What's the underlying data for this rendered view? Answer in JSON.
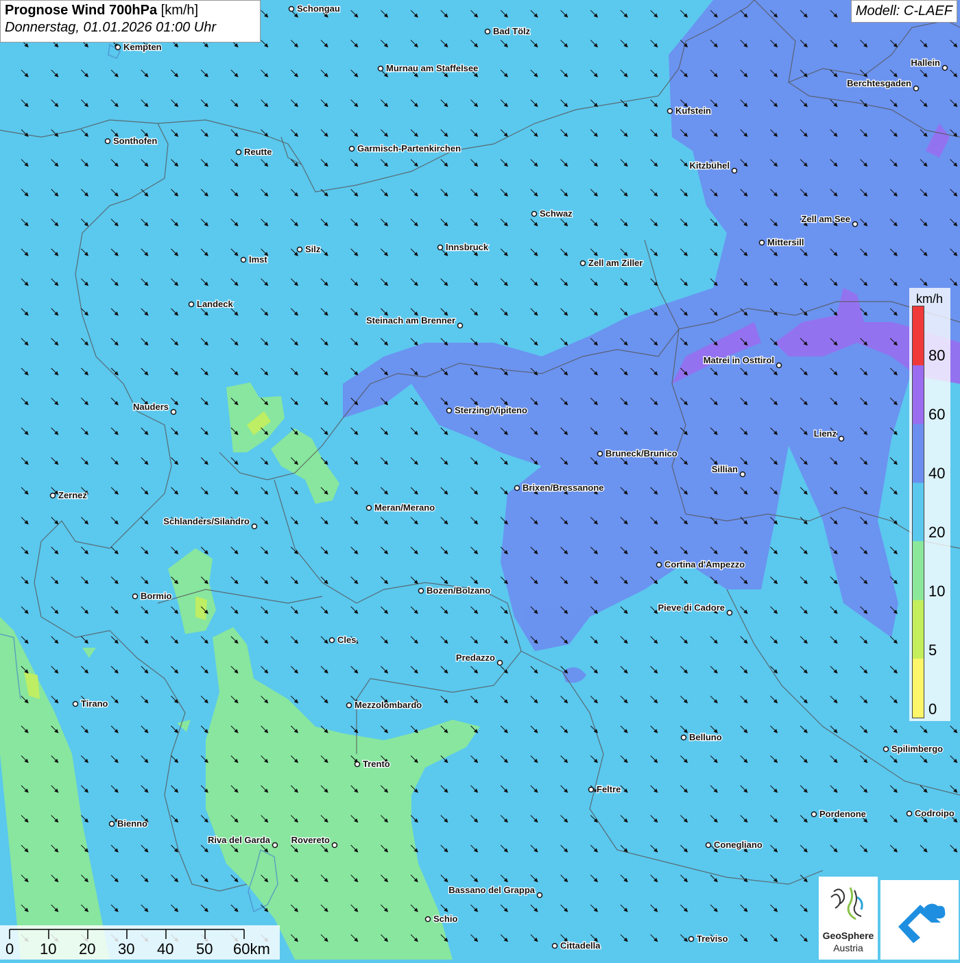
{
  "title": {
    "main": "Prognose Wind 700hPa",
    "unit": "[km/h]",
    "datetime": "Donnerstag, 01.01.2026 01:00 Uhr"
  },
  "model": "Modell: C-LAEF",
  "legend": {
    "unit": "km/h",
    "ticks": [
      "80",
      "60",
      "40",
      "20",
      "10",
      "5",
      "0"
    ],
    "colors": {
      "c0_5": "#fdf56a",
      "c5_10": "#c4ee5c",
      "c10_20": "#8be89a",
      "c20_40": "#5bc8ee",
      "c40_60": "#6c8ef0",
      "c60_80": "#9a6cf0",
      "c80_plus": "#f03a3a"
    }
  },
  "scale": {
    "labels": [
      "0",
      "10",
      "20",
      "30",
      "40",
      "50",
      "60km"
    ]
  },
  "logos": {
    "geosphere_name": "GeoSphere",
    "geosphere_sub": "Austria"
  },
  "cities": [
    {
      "name": "Schongau",
      "label": "right"
    },
    {
      "name": "Bad Tölz",
      "label": "right"
    },
    {
      "name": "Kempten",
      "label": "right"
    },
    {
      "name": "Murnau am Staffelsee",
      "label": "right"
    },
    {
      "name": "Hallein",
      "label": "left"
    },
    {
      "name": "Berchtesgaden",
      "label": "left"
    },
    {
      "name": "Kufstein",
      "label": "right"
    },
    {
      "name": "Sonthofen",
      "label": "right"
    },
    {
      "name": "Reutte",
      "label": "right"
    },
    {
      "name": "Garmisch-Partenkirchen",
      "label": "right"
    },
    {
      "name": "Kitzbühel",
      "label": "left"
    },
    {
      "name": "Schwaz",
      "label": "right"
    },
    {
      "name": "Zell am See",
      "label": "left"
    },
    {
      "name": "Mittersill",
      "label": "right"
    },
    {
      "name": "Innsbruck",
      "label": "right"
    },
    {
      "name": "Silz",
      "label": "right"
    },
    {
      "name": "Imst",
      "label": "right"
    },
    {
      "name": "Zell am Ziller",
      "label": "right"
    },
    {
      "name": "Landeck",
      "label": "right"
    },
    {
      "name": "Steinach am Brenner",
      "label": "left"
    },
    {
      "name": "Matrei in Osttirol",
      "label": "left"
    },
    {
      "name": "Nauders",
      "label": "left"
    },
    {
      "name": "Sterzing/Vipiteno",
      "label": "right"
    },
    {
      "name": "Lienz",
      "label": "left"
    },
    {
      "name": "Bruneck/Brunico",
      "label": "right"
    },
    {
      "name": "Sillian",
      "label": "left"
    },
    {
      "name": "Brixen/Bressanone",
      "label": "right"
    },
    {
      "name": "Zernez",
      "label": "right"
    },
    {
      "name": "Meran/Merano",
      "label": "right"
    },
    {
      "name": "Schlanders/Silandro",
      "label": "left"
    },
    {
      "name": "Cortina d'Ampezzo",
      "label": "right"
    },
    {
      "name": "Bozen/Bolzano",
      "label": "right"
    },
    {
      "name": "Bormio",
      "label": "right"
    },
    {
      "name": "Pieve di Cadore",
      "label": "left"
    },
    {
      "name": "Cles",
      "label": "right"
    },
    {
      "name": "Predazzo",
      "label": "left"
    },
    {
      "name": "Tirano",
      "label": "right"
    },
    {
      "name": "Mezzolombardo",
      "label": "right"
    },
    {
      "name": "Belluno",
      "label": "right"
    },
    {
      "name": "Spilimbergo",
      "label": "right"
    },
    {
      "name": "Trento",
      "label": "right"
    },
    {
      "name": "Feltre",
      "label": "right"
    },
    {
      "name": "Pordenone",
      "label": "right"
    },
    {
      "name": "Codroipo",
      "label": "right"
    },
    {
      "name": "Bienno",
      "label": "right"
    },
    {
      "name": "Riva del Garda",
      "label": "left"
    },
    {
      "name": "Rovereto",
      "label": "left"
    },
    {
      "name": "Conegliano",
      "label": "right"
    },
    {
      "name": "Bassano del Grappa",
      "label": "left"
    },
    {
      "name": "Schio",
      "label": "right"
    },
    {
      "name": "Treviso",
      "label": "right"
    },
    {
      "name": "Cittadella",
      "label": "right"
    }
  ],
  "wind_direction": "northwest"
}
